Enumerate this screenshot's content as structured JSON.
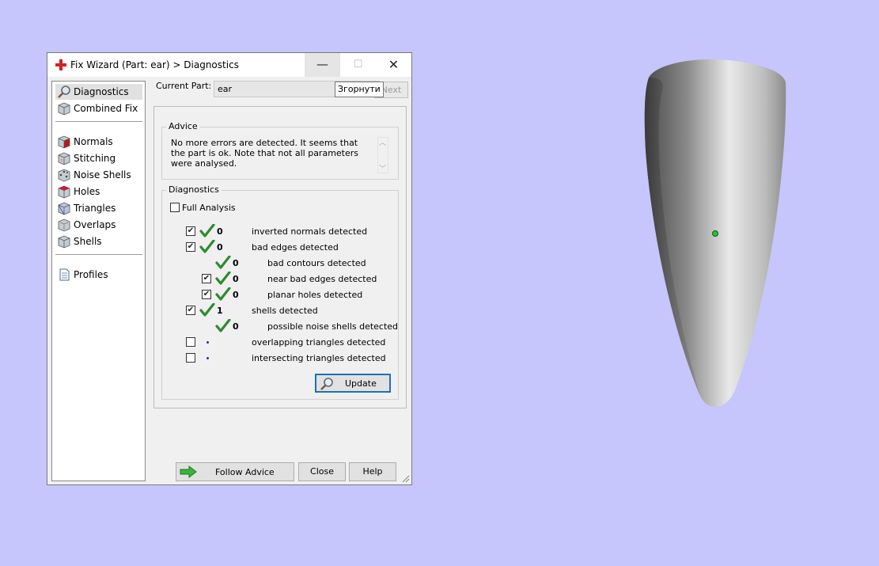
{
  "window": {
    "title": "Fix Wizard (Part: ear) > Diagnostics",
    "close_symbol": "✕",
    "minimize_symbol": "—",
    "maximize_symbol": "☐"
  },
  "sidebar": {
    "items": [
      {
        "label": "Diagnostics",
        "icon": "magnifier-icon"
      },
      {
        "label": "Combined Fix",
        "icon": "cube-icon"
      },
      {
        "label": "Normals",
        "icon": "cube-red-icon"
      },
      {
        "label": "Stitching",
        "icon": "cube-icon"
      },
      {
        "label": "Noise Shells",
        "icon": "cube-dots-icon"
      },
      {
        "label": "Holes",
        "icon": "cube-red-icon"
      },
      {
        "label": "Triangles",
        "icon": "cube-blue-icon"
      },
      {
        "label": "Overlaps",
        "icon": "cube-icon"
      },
      {
        "label": "Shells",
        "icon": "cube-icon"
      },
      {
        "label": "Profiles",
        "icon": "document-icon"
      }
    ]
  },
  "header": {
    "current_part_label": "Current Part:",
    "current_part_value": "ear",
    "tooltip": "Згорнути",
    "next_label": "Next"
  },
  "advice": {
    "title": "Advice",
    "text": "No more errors are detected. It seems that the part is ok. Note that not all parameters were analysed."
  },
  "diagnostics": {
    "title": "Diagnostics",
    "full_analysis_label": "Full Analysis",
    "rows": [
      {
        "count": "0",
        "label": "inverted normals detected"
      },
      {
        "count": "0",
        "label": "bad edges detected"
      },
      {
        "count": "0",
        "label": "bad contours detected"
      },
      {
        "count": "0",
        "label": "near bad edges detected"
      },
      {
        "count": "0",
        "label": "planar holes detected"
      },
      {
        "count": "1",
        "label": "shells detected"
      },
      {
        "count": "0",
        "label": "possible noise shells detected"
      },
      {
        "count": "",
        "label": "overlapping triangles detected"
      },
      {
        "count": "",
        "label": "intersecting triangles detected"
      }
    ],
    "update_label": "Update"
  },
  "footer": {
    "follow_advice_label": "Follow Advice",
    "close_label": "Close",
    "help_label": "Help"
  },
  "colors": {
    "desktop": "#c6c6fc",
    "check_green": "#2e8b2e",
    "focus_blue": "#1e6fb8"
  }
}
